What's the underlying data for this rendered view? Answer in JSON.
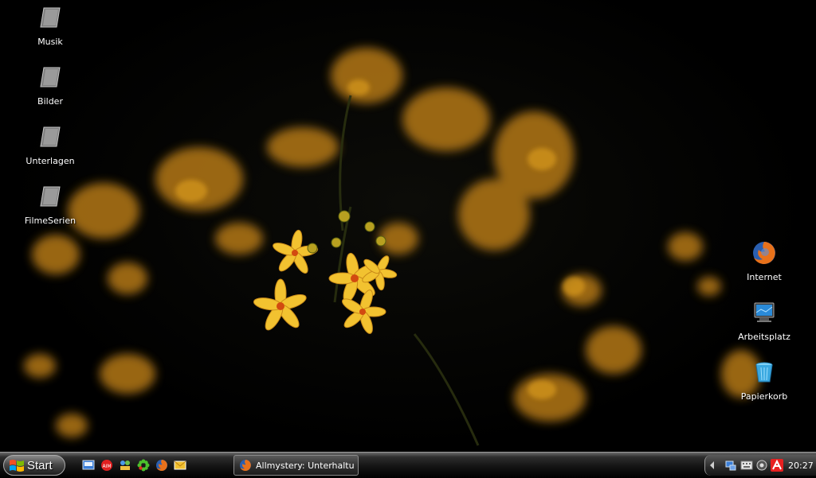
{
  "desktop": {
    "left_icons": [
      {
        "label": "Musik",
        "icon": "shortcut-folder-icon"
      },
      {
        "label": "Bilder",
        "icon": "shortcut-folder-icon"
      },
      {
        "label": "Unterlagen",
        "icon": "shortcut-folder-icon"
      },
      {
        "label": "FilmeSerien",
        "icon": "shortcut-folder-icon"
      }
    ],
    "right_icons": [
      {
        "label": "Internet",
        "icon": "firefox-icon"
      },
      {
        "label": "Arbeitsplatz",
        "icon": "computer-icon"
      },
      {
        "label": "Papierkorb",
        "icon": "recycle-bin-icon"
      }
    ]
  },
  "taskbar": {
    "start_label": "Start",
    "quick_launch": [
      "show-desktop-icon",
      "aim-icon",
      "network-icon",
      "icq-icon",
      "firefox-icon",
      "messenger-icon"
    ],
    "task_button": {
      "label": "Allmystery: Unterhaltu...",
      "icon": "firefox-icon"
    },
    "tray": {
      "icons": [
        "network-connection-icon",
        "keyboard-icon",
        "volume-icon",
        "antivir-icon"
      ],
      "clock": "20:27"
    }
  },
  "colors": {
    "flower": "#f2c230",
    "flower_dark": "#b87a10",
    "taskbar": "#141414"
  }
}
